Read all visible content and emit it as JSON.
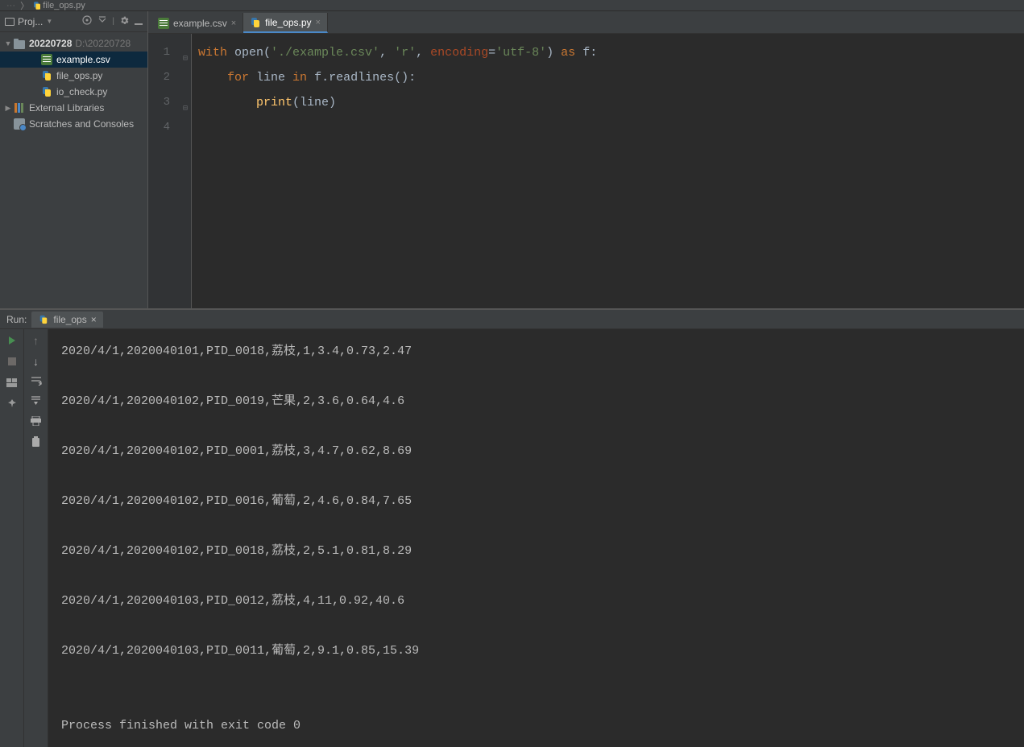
{
  "breadcrumb": {
    "file": "file_ops.py"
  },
  "project": {
    "panel_title": "Proj...",
    "root": {
      "name": "20220728",
      "path": "D:\\20220728"
    },
    "files": [
      {
        "name": "example.csv",
        "type": "csv",
        "selected": true
      },
      {
        "name": "file_ops.py",
        "type": "py",
        "selected": false
      },
      {
        "name": "io_check.py",
        "type": "py",
        "selected": false
      }
    ],
    "external_libs": "External Libraries",
    "scratches": "Scratches and Consoles"
  },
  "tabs": [
    {
      "label": "example.csv",
      "type": "csv",
      "active": false
    },
    {
      "label": "file_ops.py",
      "type": "py",
      "active": true
    }
  ],
  "code": {
    "lines": [
      1,
      2,
      3,
      4
    ],
    "l1_kw_with": "with",
    "l1_open": " open(",
    "l1_str1": "'./example.csv'",
    "l1_c1": ", ",
    "l1_str2": "'r'",
    "l1_c2": ", ",
    "l1_enc": "encoding",
    "l1_eq": "=",
    "l1_str3": "'utf-8'",
    "l1_close": ") ",
    "l1_as": "as",
    "l1_f": " f:",
    "l2_indent": "    ",
    "l2_for": "for",
    "l2_mid": " line ",
    "l2_in": "in",
    "l2_rest": " f.readlines():",
    "l3_indent": "        ",
    "l3_print": "print",
    "l3_rest": "(line)"
  },
  "run": {
    "label": "Run:",
    "tab_name": "file_ops"
  },
  "console_output": [
    "2020/4/1,2020040101,PID_0018,荔枝,1,3.4,0.73,2.47",
    "",
    "2020/4/1,2020040102,PID_0019,芒果,2,3.6,0.64,4.6",
    "",
    "2020/4/1,2020040102,PID_0001,荔枝,3,4.7,0.62,8.69",
    "",
    "2020/4/1,2020040102,PID_0016,葡萄,2,4.6,0.84,7.65",
    "",
    "2020/4/1,2020040102,PID_0018,荔枝,2,5.1,0.81,8.29",
    "",
    "2020/4/1,2020040103,PID_0012,荔枝,4,11,0.92,40.6",
    "",
    "2020/4/1,2020040103,PID_0011,葡萄,2,9.1,0.85,15.39",
    "",
    "",
    "Process finished with exit code 0"
  ]
}
